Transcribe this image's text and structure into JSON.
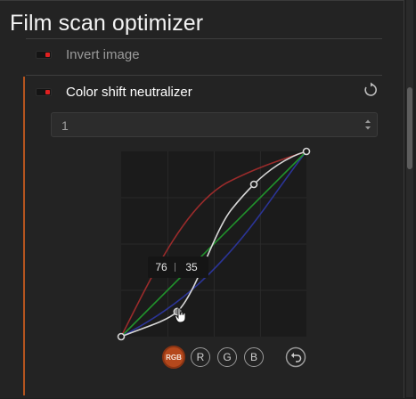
{
  "panel": {
    "title": "Film scan optimizer"
  },
  "modules": [
    {
      "label": "Invert image",
      "enabled": false
    },
    {
      "label": "Color shift neutralizer",
      "enabled": true
    }
  ],
  "preset_select": {
    "value": "1"
  },
  "curve": {
    "tooltip_in": "76",
    "tooltip_out": "35",
    "channel_buttons": [
      {
        "label": "RGB",
        "active": true
      },
      {
        "label": "R",
        "active": false
      },
      {
        "label": "G",
        "active": false
      },
      {
        "label": "B",
        "active": false
      }
    ]
  },
  "icons": {
    "reset": "reset-icon",
    "undo": "undo-icon",
    "select_arrows": "updown-arrows-icon",
    "cursor": "hand-pointer-icon"
  },
  "colors": {
    "accent": "#b4481c",
    "module_bar": "#b4541f",
    "toggle_on": "#e02020"
  }
}
